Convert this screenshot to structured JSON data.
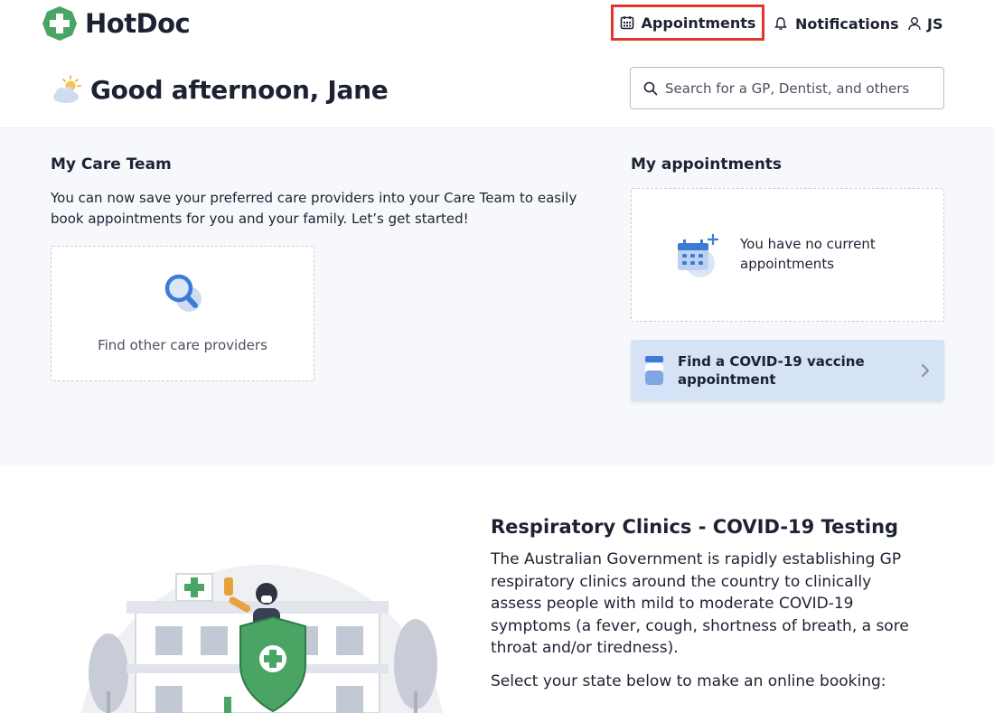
{
  "brand": {
    "name": "HotDoc",
    "color": "#4aa564"
  },
  "nav": {
    "appointments": "Appointments",
    "notifications": "Notifications",
    "user_initials": "JS",
    "highlight_color": "#e0362c"
  },
  "header": {
    "greeting": "Good afternoon, Jane",
    "search_placeholder": "Search for a GP, Dentist, and others"
  },
  "care_team": {
    "title": "My Care Team",
    "description": "You can now save your preferred care providers into your Care Team to easily book appointments for you and your family. Let’s get started!",
    "find_label": "Find other care providers"
  },
  "appointments": {
    "title": "My appointments",
    "empty_text": "You have no current appointments",
    "covid_button": "Find a COVID-19 vaccine appointment"
  },
  "respiratory": {
    "title": "Respiratory Clinics - COVID-19 Testing",
    "body": "The Australian Government is rapidly establishing GP respiratory clinics around the country to clinically assess people with mild to moderate COVID-19 symptoms (a fever, cough, shortness of breath, a sore throat and/or tiredness).",
    "select_state": "Select your state below to make an online booking:"
  }
}
